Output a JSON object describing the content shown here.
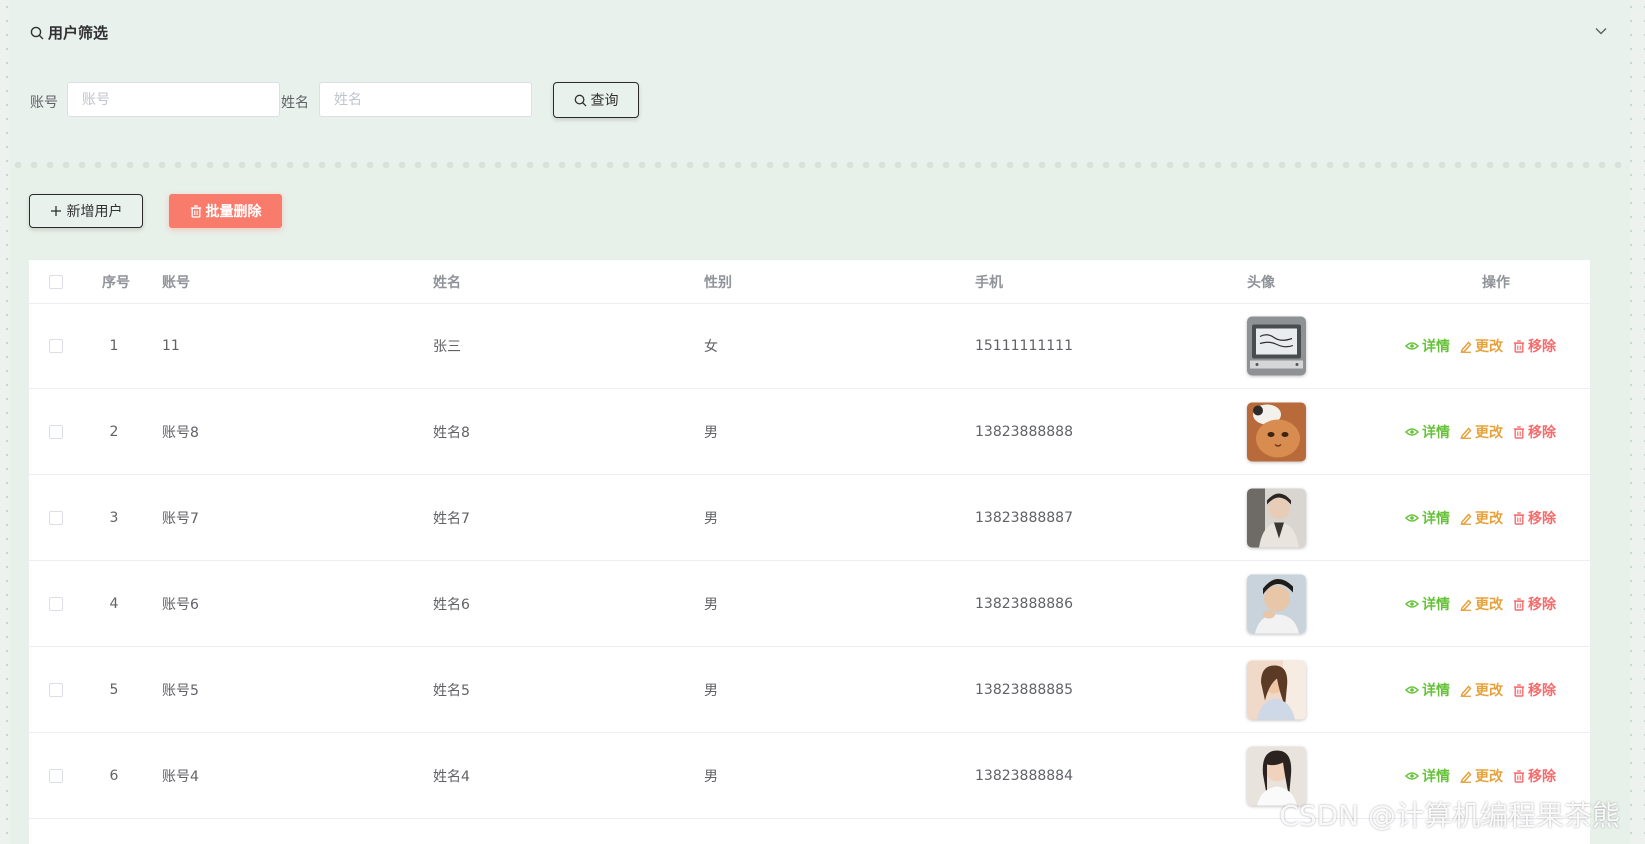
{
  "filter": {
    "title": "用户筛选",
    "account_label": "账号",
    "account_placeholder": "账号",
    "account_value": "",
    "name_label": "姓名",
    "name_placeholder": "姓名",
    "name_value": "",
    "query_label": "查询"
  },
  "toolbar": {
    "add_label": "新增用户",
    "batch_delete_label": "批量删除"
  },
  "table": {
    "headers": {
      "index": "序号",
      "account": "账号",
      "name": "姓名",
      "gender": "性别",
      "phone": "手机",
      "avatar": "头像",
      "actions": "操作"
    },
    "rows": [
      {
        "index": "1",
        "account": "11",
        "name": "张三",
        "gender": "女",
        "phone": "15111111111",
        "avatar_icon": "avatar-image-study-desk"
      },
      {
        "index": "2",
        "account": "账号8",
        "name": "姓名8",
        "gender": "男",
        "phone": "13823888888",
        "avatar_icon": "avatar-image-cat"
      },
      {
        "index": "3",
        "account": "账号7",
        "name": "姓名7",
        "gender": "男",
        "phone": "13823888887",
        "avatar_icon": "avatar-image-person"
      },
      {
        "index": "4",
        "account": "账号6",
        "name": "姓名6",
        "gender": "男",
        "phone": "13823888886",
        "avatar_icon": "avatar-image-person"
      },
      {
        "index": "5",
        "account": "账号5",
        "name": "姓名5",
        "gender": "男",
        "phone": "13823888885",
        "avatar_icon": "avatar-image-person"
      },
      {
        "index": "6",
        "account": "账号4",
        "name": "姓名4",
        "gender": "男",
        "phone": "13823888884",
        "avatar_icon": "avatar-image-person"
      }
    ],
    "actions": {
      "detail": "详情",
      "edit": "更改",
      "remove": "移除"
    }
  },
  "watermark": "CSDN @计算机编程果茶熊",
  "colors": {
    "background": "#e9f1ec",
    "danger_button": "#f87b6c",
    "detail": "#67c23a",
    "edit": "#e6a23c",
    "remove": "#f56c6c"
  }
}
